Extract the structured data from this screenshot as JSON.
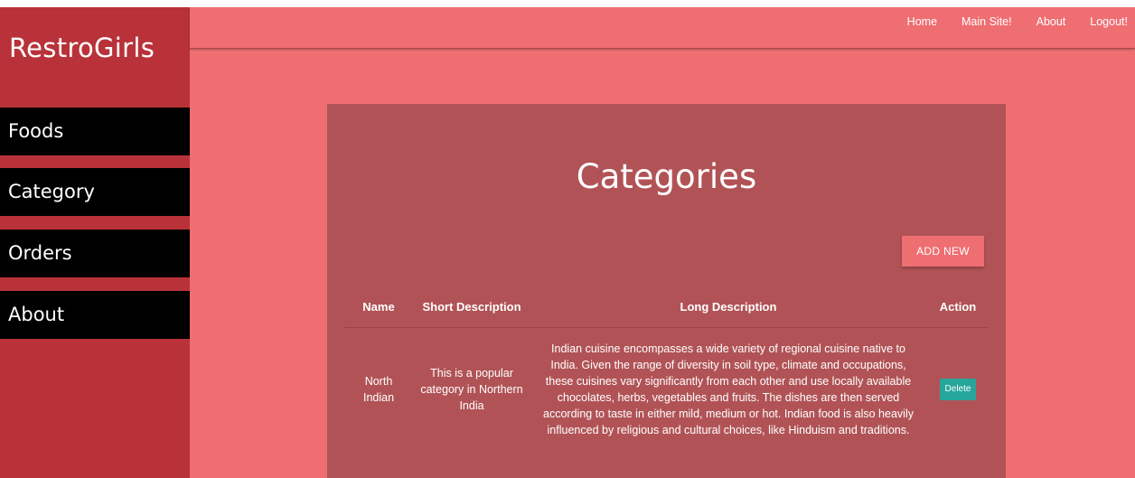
{
  "sidebar": {
    "brand": "RestroGirls",
    "items": [
      {
        "label": "Foods"
      },
      {
        "label": "Category"
      },
      {
        "label": "Orders"
      },
      {
        "label": "About"
      }
    ]
  },
  "topnav": {
    "items": [
      {
        "label": "Home"
      },
      {
        "label": "Main Site!"
      },
      {
        "label": "About"
      },
      {
        "label": "Logout!"
      }
    ]
  },
  "main": {
    "title": "Categories",
    "add_button": "ADD NEW",
    "table": {
      "columns": [
        "Name",
        "Short Description",
        "Long Description",
        "Action"
      ],
      "rows": [
        {
          "name": "North Indian",
          "short": "This is a popular category in Northern India",
          "long": "Indian cuisine encompasses a wide variety of regional cuisine native to India. Given the range of diversity in soil type, climate and occupations, these cuisines vary significantly from each other and use locally available chocolates, herbs, vegetables and fruits. The dishes are then served according to taste in either mild, medium or hot. Indian food is also heavily influenced by religious and cultural choices, like Hinduism and traditions.",
          "action": "Delete"
        }
      ]
    }
  },
  "colors": {
    "sidebar_bg": "#b93239",
    "main_bg": "#ef6e72",
    "panel_bg": "#b15356",
    "nav_item_bg": "#000000",
    "delete_btn": "#26a69a"
  }
}
